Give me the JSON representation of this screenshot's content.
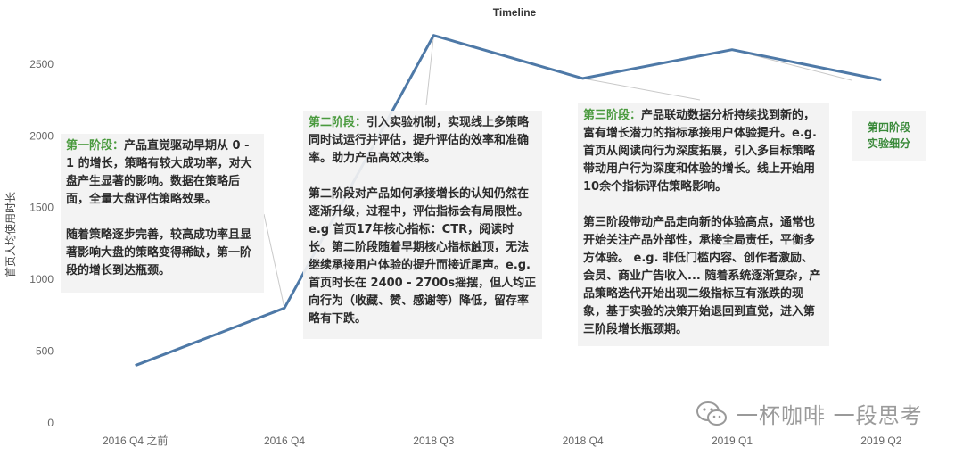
{
  "chart_data": {
    "type": "line",
    "title": "Timeline",
    "xlabel": "",
    "ylabel": "首页人均使用时长",
    "categories": [
      "2016 Q4 之前",
      "2016 Q4",
      "2018 Q3",
      "2018 Q4",
      "2019 Q1",
      "2019 Q2"
    ],
    "series": [
      {
        "values": [
          400,
          800,
          2700,
          2400,
          2600,
          2390
        ]
      }
    ],
    "yticks": [
      0,
      500,
      1000,
      1500,
      2000,
      2500
    ],
    "ylim": [
      0,
      2760
    ],
    "grid": false,
    "line_color": "#4e79a7"
  },
  "annotations": {
    "stage1": {
      "label": "第一阶段：",
      "p1": "产品直觉驱动早期从 0 - 1 的增长，策略有较大成功率，对大盘产生显著的影响。数据在策略后面，全量大盘评估策略效果。",
      "p2": "随着策略逐步完善，较高成功率且显著影响大盘的策略变得稀缺，第一阶段的增长到达瓶颈。"
    },
    "stage2": {
      "label": "第二阶段：",
      "p1": "引入实验机制，实现线上多策略同时试运行并评估，提升评估的效率和准确率。助力产品高效决策。",
      "p2": "第二阶段对产品如何承接增长的认知仍然在逐渐升级，过程中，评估指标会有局限性。e.g 首页17年核心指标：CTR，阅读时长。第二阶段随着早期核心指标触顶，无法继续承接用户体验的提升而接近尾声。e.g. 首页时长在 2400 - 2700s摇摆，但人均正向行为（收藏、赞、感谢等）降低，留存率略有下跌。"
    },
    "stage3": {
      "label": "第三阶段：",
      "p1": "产品联动数据分析持续找到新的，富有增长潜力的指标承接用户体验提升。e.g. 首页从阅读向行为深度拓展，引入多目标策略带动用户行为深度和体验的增长。线上开始用10余个指标评估策略影响。",
      "p2": "第三阶段带动产品走向新的体验高点，通常也开始关注产品外部性，承接全局责任，平衡多方体验。 e.g. 非低门槛内容、创作者激励、会员、商业广告收入... 随着系统逐渐复杂，产品策略迭代开始出现二级指标互有涨跌的现象，基于实验的决策开始退回到直觉，进入第三阶段增长瓶颈期。"
    },
    "stage4": {
      "line1": "第四阶段",
      "line2": "实验细分"
    }
  },
  "watermark": {
    "text": "一杯咖啡 一段思考",
    "icon": "wechat-icon"
  }
}
